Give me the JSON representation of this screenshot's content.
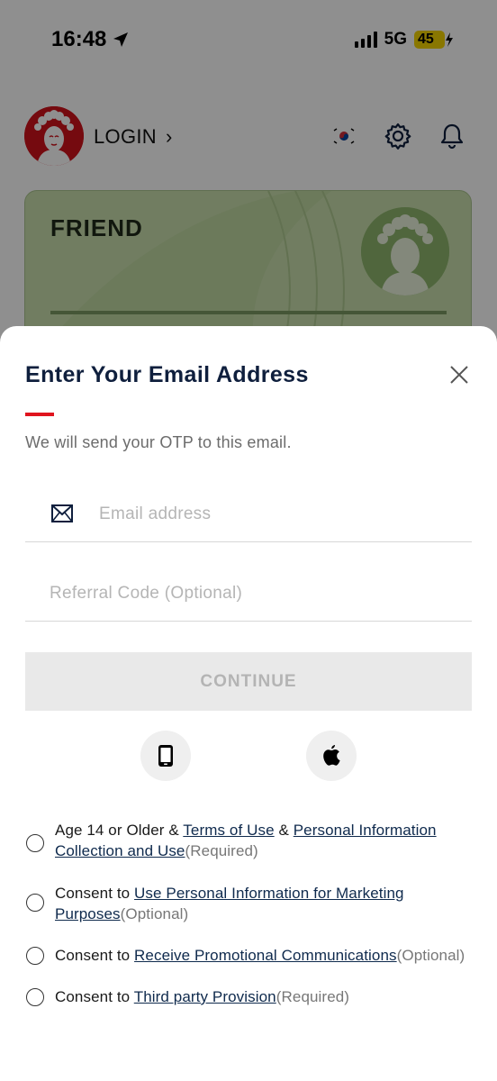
{
  "status_bar": {
    "time": "16:48",
    "network": "5G",
    "battery": "45"
  },
  "header": {
    "login_label": "LOGIN",
    "login_chevron": "›",
    "icons": [
      "korea-flag-icon",
      "gear-icon",
      "bell-icon"
    ]
  },
  "member_card": {
    "tier": "FRIEND",
    "color": "#c9dfad"
  },
  "sheet": {
    "title": "Enter Your Email Address",
    "subtitle": "We will send your OTP to this email.",
    "email_placeholder": "Email address",
    "referral_placeholder": "Referral Code (Optional)",
    "continue_label": "CONTINUE",
    "alt_login_icons": [
      "phone-icon",
      "apple-icon"
    ],
    "accent_color": "#e0141e"
  },
  "consents": [
    {
      "prefix": "Age 14 or Older & ",
      "link1": "Terms of Use",
      "mid": " & ",
      "link2": "Personal Information Collection and Use",
      "suffix": "(Required)"
    },
    {
      "prefix": "Consent to ",
      "link1": "Use Personal Information for Marketing Purposes",
      "suffix": "(Optional)"
    },
    {
      "prefix": "Consent to ",
      "link1": "Receive Promotional Communications",
      "suffix": "(Optional)"
    },
    {
      "prefix": "Consent to ",
      "link1": "Third party Provision",
      "suffix": "(Required)"
    }
  ]
}
